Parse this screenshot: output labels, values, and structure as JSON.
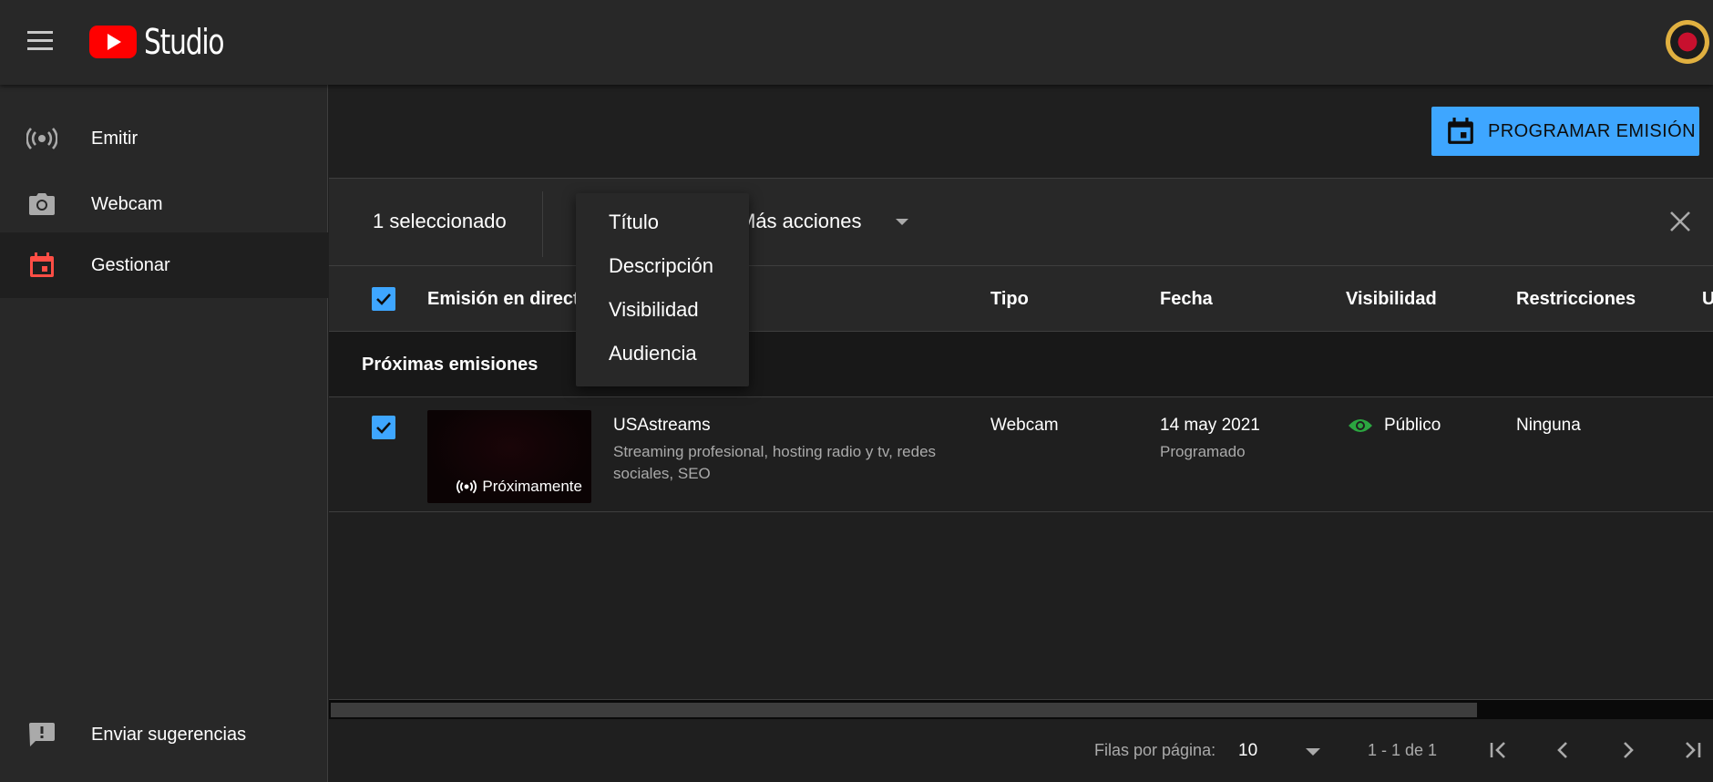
{
  "header": {
    "logo_text": "Studio",
    "brand_color": "#ff0000"
  },
  "sidebar": {
    "items": [
      {
        "label": "Emitir",
        "icon": "broadcast-icon"
      },
      {
        "label": "Webcam",
        "icon": "camera-icon"
      },
      {
        "label": "Gestionar",
        "icon": "calendar-icon",
        "active": true
      }
    ],
    "feedback": {
      "label": "Enviar sugerencias",
      "icon": "feedback-icon"
    }
  },
  "toolbar": {
    "schedule_label": "PROGRAMAR EMISIÓN",
    "accent_color": "#3ea6ff"
  },
  "action_bar": {
    "selected_count": "1 seleccionado",
    "more_actions": "Más acciones"
  },
  "menu": {
    "items": [
      "Título",
      "Descripción",
      "Visibilidad",
      "Audiencia"
    ]
  },
  "table": {
    "columns": [
      "Emisión en direct",
      "Tipo",
      "Fecha",
      "Visibilidad",
      "Restricciones",
      "U"
    ],
    "section_title": "Próximas emisiones",
    "rows": [
      {
        "title": "USAstreams",
        "description": "Streaming profesional, hosting radio y tv, redes sociales, SEO",
        "badge": "Próximamente",
        "type": "Webcam",
        "date": "14 may 2021",
        "date_status": "Programado",
        "visibility": "Público",
        "visibility_color": "#2ba640",
        "restrictions": "Ninguna"
      }
    ]
  },
  "pagination": {
    "rows_label": "Filas por página:",
    "rows_value": "10",
    "range": "1 - 1 de 1"
  }
}
